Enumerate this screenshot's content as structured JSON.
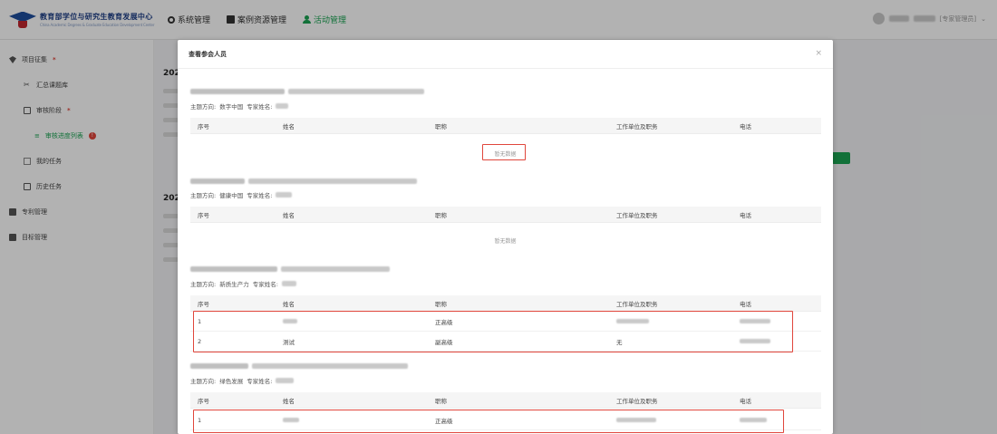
{
  "app": {
    "logo_title": "教育部学位与研究生教育发展中心",
    "logo_sub": "China Academic Degrees & Graduate Education Development Center"
  },
  "topnav": {
    "items": [
      {
        "label": "系统管理",
        "icon": "gear-icon",
        "active": false
      },
      {
        "label": "案例资源管理",
        "icon": "book-icon",
        "active": false
      },
      {
        "label": "活动管理",
        "icon": "person-icon",
        "active": true
      }
    ]
  },
  "user": {
    "name": "[专家管理员]"
  },
  "sidebar": {
    "items": [
      {
        "label": "项目征集",
        "level": 0,
        "icon": "pin-icon",
        "dot": "*"
      },
      {
        "label": "汇总课题库",
        "level": 1,
        "icon": "scissors-icon"
      },
      {
        "label": "审核阶段",
        "level": 1,
        "icon": "doc-icon",
        "dot": "*"
      },
      {
        "label": "审核进度列表",
        "level": 2,
        "icon": "list-icon",
        "badge": "!"
      },
      {
        "label": "我的任务",
        "level": 1,
        "icon": "box-icon"
      },
      {
        "label": "历史任务",
        "level": 1,
        "icon": "doc-icon"
      },
      {
        "label": "专利管理",
        "level": 0,
        "icon": "book-icon"
      },
      {
        "label": "目标管理",
        "level": 0,
        "icon": "book-icon"
      }
    ]
  },
  "background": {
    "years": [
      "202",
      "202"
    ]
  },
  "modal": {
    "title": "查看参会人员",
    "close_label": "×",
    "columns": {
      "no": "序号",
      "name": "姓名",
      "title": "职称",
      "unit": "工作单位及职务",
      "phone": "电话"
    },
    "empty_text": "暂无数据",
    "groups": [
      {
        "topic_label": "主题方向:",
        "topic": "数字中国",
        "expert_label": "专家姓名:",
        "rows": []
      },
      {
        "topic_label": "主题方向:",
        "topic": "健康中国",
        "expert_label": "专家姓名:",
        "rows": []
      },
      {
        "topic_label": "主题方向:",
        "topic": "新质生产力",
        "expert_label": "专家姓名:",
        "rows": [
          {
            "no": "1",
            "name": "",
            "title": "正高级",
            "unit": "",
            "phone": ""
          },
          {
            "no": "2",
            "name": "测试",
            "title": "副高级",
            "unit": "无",
            "phone": ""
          }
        ]
      },
      {
        "topic_label": "主题方向:",
        "topic": "绿色发展",
        "expert_label": "专家姓名:",
        "rows": [
          {
            "no": "1",
            "name": "",
            "title": "正高级",
            "unit": "",
            "phone": ""
          }
        ]
      }
    ]
  },
  "colors": {
    "brand_green": "#1aa352",
    "highlight_red": "#e0463c",
    "brand_blue": "#1f4e9c"
  }
}
